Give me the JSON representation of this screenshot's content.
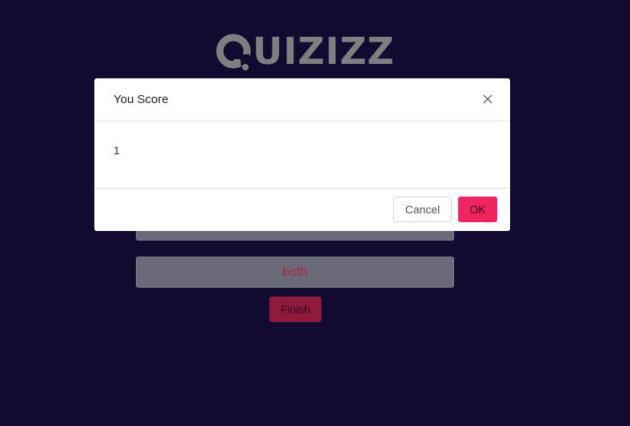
{
  "logo": {
    "text": "UIZIZZ",
    "icon": "quizizz-q-logo"
  },
  "quiz": {
    "option_text": "both",
    "finish_label": "Finish"
  },
  "modal": {
    "title": "You Score",
    "score": "1",
    "close_icon": "close-icon",
    "cancel_label": "Cancel",
    "ok_label": "OK"
  },
  "colors": {
    "background": "#130a31",
    "accent": "#f0245f",
    "logo_gray": "#7f7f80"
  }
}
